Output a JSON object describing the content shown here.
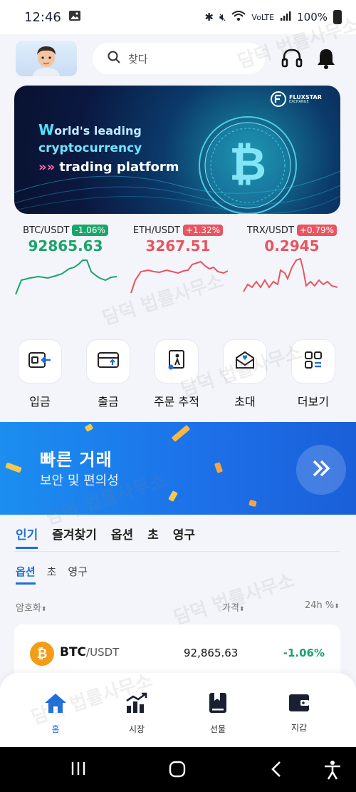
{
  "status_bar": {
    "time": "12:46",
    "signal_text": "VoLTE",
    "battery": "100%"
  },
  "header": {
    "search_placeholder": "찾다",
    "icons": [
      "headset-icon",
      "bell-icon"
    ]
  },
  "banner": {
    "logo_name": "FLUXSTAR",
    "logo_sub": "EXCHANGE",
    "line1_first": "W",
    "line1_rest": "orld's leading",
    "line2": "cryptocurrency",
    "line3_arrow": "»»",
    "line3": "trading platform"
  },
  "tickers": [
    {
      "pair": "BTC/USDT",
      "change": "-1.06%",
      "price": "92865.63",
      "color": "#1aa56b"
    },
    {
      "pair": "ETH/USDT",
      "change": "+1.32%",
      "price": "3267.51",
      "color": "#e8545f"
    },
    {
      "pair": "TRX/USDT",
      "change": "+0.79%",
      "price": "0.2945",
      "color": "#e8545f"
    }
  ],
  "actions": [
    {
      "label": "입금",
      "icon": "wallet-deposit-icon"
    },
    {
      "label": "출금",
      "icon": "card-withdraw-icon"
    },
    {
      "label": "주문 추적",
      "icon": "order-track-icon"
    },
    {
      "label": "초대",
      "icon": "invite-mail-icon"
    },
    {
      "label": "더보기",
      "icon": "grid-more-icon"
    }
  ],
  "promo": {
    "title": "빠른 거래",
    "subtitle": "보안 및 편의성"
  },
  "tabs": [
    "인기",
    "즐겨찾기",
    "옵션",
    "초",
    "영구"
  ],
  "subtabs": [
    "옵션",
    "초",
    "영구"
  ],
  "columns": {
    "coin": "암호화",
    "price": "가격",
    "change": "24h %"
  },
  "rows": [
    {
      "base": "BTC",
      "quote": "/USDT",
      "price": "92,865.63",
      "change": "-1.06%"
    }
  ],
  "bottom_nav": [
    {
      "label": "홈",
      "icon": "home-icon"
    },
    {
      "label": "시장",
      "icon": "market-chart-icon"
    },
    {
      "label": "선물",
      "icon": "futures-book-icon"
    },
    {
      "label": "지갑",
      "icon": "wallet-icon"
    }
  ],
  "watermark": "담덕 법률사무소"
}
